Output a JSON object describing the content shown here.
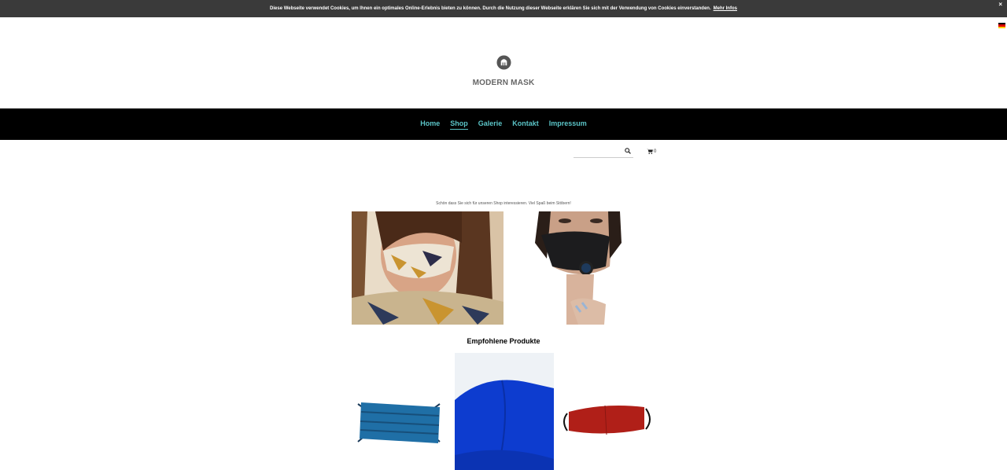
{
  "cookie": {
    "text": "Diese Webseite verwendet Cookies, um Ihnen ein optimales Online-Erlebnis bieten zu können. Durch die Nutzung dieser Webseite erklären Sie sich mit der Verwendung von Cookies einverstanden.",
    "link": "Mehr Infos",
    "close": "×"
  },
  "brand": {
    "name": "MODERN MASK"
  },
  "nav": {
    "items": [
      {
        "label": "Home"
      },
      {
        "label": "Shop"
      },
      {
        "label": "Galerie"
      },
      {
        "label": "Kontakt"
      },
      {
        "label": "Impressum"
      }
    ],
    "active": "Shop"
  },
  "search": {
    "value": "",
    "placeholder": ""
  },
  "cart": {
    "count": "0"
  },
  "intro": "Schön dass Sie sich für unseren Shop interessieren. Viel Spaß beim Stöbern!",
  "featured": {
    "title": "Empfohlene Produkte"
  },
  "colors": {
    "nav_bg": "#000000",
    "nav_link": "#5bc4c7",
    "cookie_bg": "#3a3a3a",
    "flag": [
      "#000000",
      "#dd0000",
      "#ffce00"
    ]
  }
}
